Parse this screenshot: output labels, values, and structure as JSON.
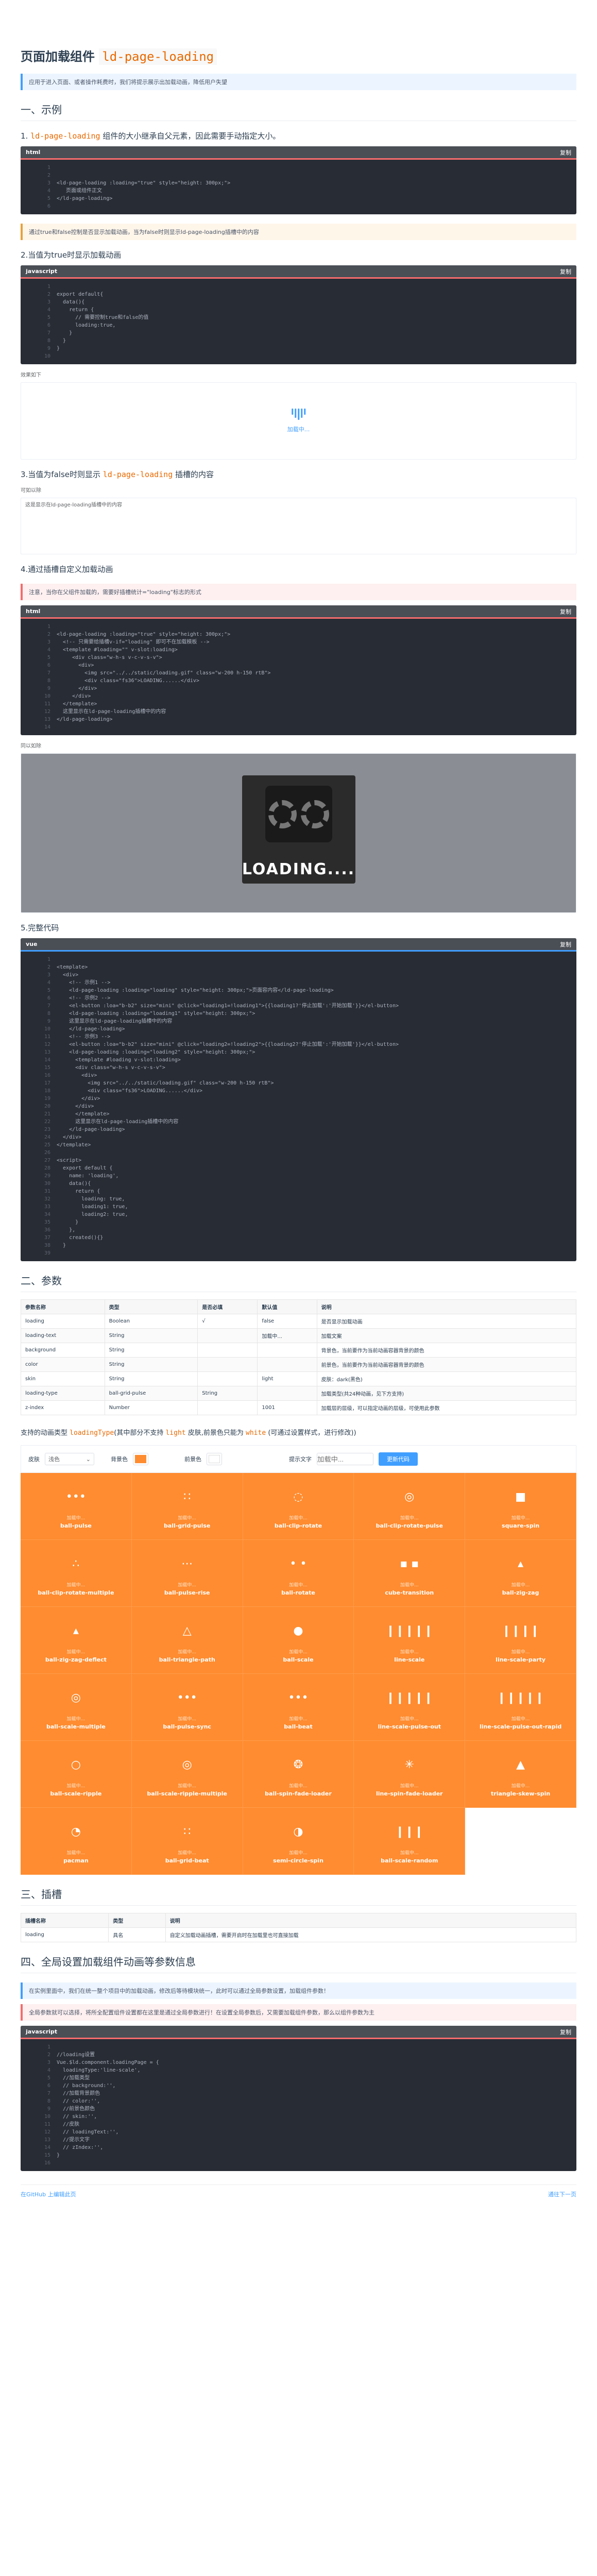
{
  "title": {
    "text": "页面加载组件",
    "code": "ld-page-loading"
  },
  "tip1": "应用于进入页面、或者操作耗费时，我们将提示展示出加载动画，降低用户失望",
  "sec1": "一、示例",
  "h_1": {
    "pre": "1.",
    "code": "ld-page-loading",
    "post": "组件的大小继承自父元素，因此需要手动指定大小。"
  },
  "code1": {
    "lang": "html",
    "copy": "复制",
    "lines": [
      "",
      "",
      "<ld-page-loading :loading=\"true\" style=\"height: 300px;\">",
      "   页面或组件正文",
      "</ld-page-loading>",
      ""
    ]
  },
  "tip2": "通过true和false控制是否显示加载动画，当为false时则显示ld-page-loading插槽中的内容",
  "h_2": "2.当值为true时显示加载动画",
  "code2": {
    "lang": "javascript",
    "copy": "复制",
    "lines": [
      "",
      "export default{",
      "  data(){",
      "    return {",
      "      // 需要控制true和false的值",
      "      loading:true,",
      "    }",
      "  }",
      "}",
      ""
    ]
  },
  "demo2": {
    "label": "效果如下",
    "text": "加载中..."
  },
  "h_3": {
    "pre": "3.当值为false时则显示",
    "code": "ld-page-loading",
    "post": "插槽的内容"
  },
  "demo3": {
    "label": "可如以除",
    "text": "这是显示在ld-page-loading插槽中的内容"
  },
  "h_4": "4.通过插槽自定义加载动画",
  "tip3": "注意，当你在父组件加载的，需要好插槽统计=\"loading\"标志的形式",
  "code4": {
    "lang": "html",
    "copy": "复制",
    "lines": [
      "",
      "<ld-page-loading :loading=\"true\" style=\"height: 300px;\">",
      "  <!-- 只需要给插槽v-if=\"loading\" 即可不在加载模板 -->",
      "  <template #loading=\"\" v-slot:loading>",
      "     <div class=\"w-h-s v-c-v-s-v\">",
      "       <div>",
      "         <img src=\"../../static/loading.gif\" class=\"w-200 h-150 rtB\">",
      "         <div class=\"fs36\">LOADING......</div>",
      "       </div>",
      "     </div>",
      "  </template>",
      "  这里显示在ld-page-loading插槽中的内容",
      "</ld-page-loading>",
      ""
    ]
  },
  "demo4": {
    "label": "同以如除",
    "loading": "LOADING...."
  },
  "h_5": "5.完整代码",
  "code5": {
    "lang": "vue",
    "copy": "复制",
    "lines": [
      "",
      "<template>",
      "  <div>",
      "    <!-- 示例1 -->",
      "    <ld-page-loading :loading=\"loading\" style=\"height: 300px;\">页面容内容</ld-page-loading>",
      "    <!-- 示例2 -->",
      "    <el-button :loa=\"b-b2\" size=\"mini\" @click=\"loading1=!loading1\">{{loading1?'停止加载':'开始加载'}}</el-button>",
      "    <ld-page-loading :loading=\"loading1\" style=\"height: 300px;\">",
      "    这里显示在ld-page-loading插槽中的内容",
      "    </ld-page-loading>",
      "    <!-- 示例3 -->",
      "    <el-button :loa=\"b-b2\" size=\"mini\" @click=\"loading2=!loading2\">{{loading2?'停止加载':'开始加载'}}</el-button>",
      "    <ld-page-loading :loading=\"loading2\" style=\"height: 300px;\">",
      "      <template #loading v-slot:loading>",
      "      <div class=\"w-h-s v-c-v-s-v\">",
      "        <div>",
      "          <img src=\"../../static/loading.gif\" class=\"w-200 h-150 rtB\">",
      "          <div class=\"fs36\">LOADING......</div>",
      "        </div>",
      "      </div>",
      "      </template>",
      "      这里显示在ld-page-loading插槽中的内容",
      "    </ld-page-loading>",
      "  </div>",
      "</template>",
      "",
      "<script>",
      "  export default {",
      "    name: 'loading',",
      "    data(){",
      "      return {",
      "        loading: true,",
      "        loading1: true,",
      "        loading2: true,",
      "      }",
      "    },",
      "    created(){}",
      "  }",
      ""
    ]
  },
  "sec2": "二、参数",
  "params": {
    "headers": [
      "参数名称",
      "类型",
      "是否必填",
      "默认值",
      "说明"
    ],
    "rows": [
      [
        "loading",
        "Boolean",
        "√",
        "false",
        "是否显示加载动画"
      ],
      [
        "loading-text",
        "String",
        "",
        "加载中...",
        "加载文案"
      ],
      [
        "background",
        "String",
        "",
        "",
        "背景色，当前要作为当前动画容器背景的颜色"
      ],
      [
        "color",
        "String",
        "",
        "",
        "前景色，当前要作为当前动画容器背景的颜色"
      ],
      [
        "skin",
        "String",
        "",
        "light",
        "皮肤：dark(黑色)"
      ],
      [
        "loading-type",
        "ball-grid-pulse",
        "String",
        "",
        "加载类型(共24种动画，见下方支持)"
      ],
      [
        "z-index",
        "Number",
        "",
        "1001",
        "加载层的层级，可以指定动画的层级，可使用此参数"
      ]
    ]
  },
  "intro": {
    "pre": "支持的动画类型",
    "code": "loadingType",
    "mid": "(其中部分不支持",
    "code2": "light",
    "mid2": "皮肤,前景色只能为",
    "code3": "white",
    "post": "(可通过设置样式，进行修改))"
  },
  "toolbar": {
    "skin_label": "皮肤",
    "skin_value": "浅色",
    "bg_label": "背景色",
    "fg_label": "前景色",
    "text_label": "提示文字",
    "text_placeholder": "加载中...",
    "btn": "更新代码",
    "colors": {
      "bg": "#ff8c30",
      "fg": "#ffffff"
    }
  },
  "loading_text": "加载中...",
  "animations": [
    "ball-pulse",
    "ball-grid-pulse",
    "ball-clip-rotate",
    "ball-clip-rotate-pulse",
    "square-spin",
    "ball-clip-rotate-multiple",
    "ball-pulse-rise",
    "ball-rotate",
    "cube-transition",
    "ball-zig-zag",
    "ball-zig-zag-deflect",
    "ball-triangle-path",
    "ball-scale",
    "line-scale",
    "line-scale-party",
    "ball-scale-multiple",
    "ball-pulse-sync",
    "ball-beat",
    "line-scale-pulse-out",
    "line-scale-pulse-out-rapid",
    "ball-scale-ripple",
    "ball-scale-ripple-multiple",
    "ball-spin-fade-loader",
    "line-spin-fade-loader",
    "triangle-skew-spin",
    "pacman",
    "ball-grid-beat",
    "semi-circle-spin",
    "ball-scale-random"
  ],
  "sec3": "三、插槽",
  "slots": {
    "headers": [
      "插槽名称",
      "类型",
      "说明"
    ],
    "rows": [
      [
        "loading",
        "具名",
        "自定义加载动画插槽，需要开启时在加载里也可直接加载"
      ]
    ]
  },
  "sec4": "四、全局设置加载组件动画等参数信息",
  "tip4": "在实例里面中，我们在统一整个项目中的加载动画，修改后等待模块统一，此时可以通过全局参数设置，加载组件参数！",
  "tip5": "全局参数就可以选择，将所全配置组件设置都在这里是通过全局参数进行！在设置全局参数后，又需要加载组件参数，那么以组件参数为主",
  "code6": {
    "lang": "javascript",
    "copy": "复制",
    "lines": [
      "",
      "//loading设置",
      "Vue.$ld.component.loadingPage = {",
      "  loadingType:'line-scale',",
      "  //加载类型",
      "  // background:'',",
      "  //加载背景颜色",
      "  // color:'',",
      "  //前景色颜色",
      "  // skin:'',",
      "  //皮肤",
      "  // loadingText:'',",
      "  //提示文字",
      "  // zIndex:'',",
      "}",
      ""
    ]
  },
  "footer": {
    "left": "在GitHub 上编辑此页",
    "right": "通往下一页"
  }
}
